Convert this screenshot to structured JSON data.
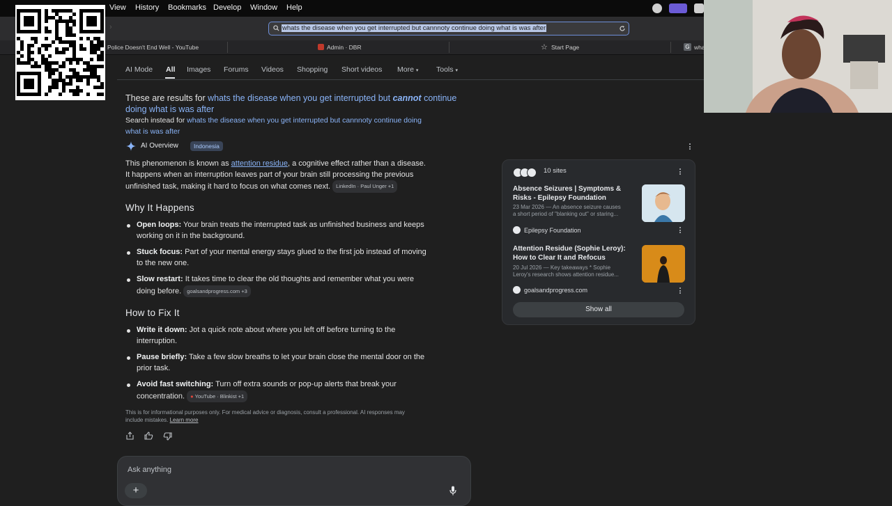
{
  "menubar": {
    "items": [
      "View",
      "History",
      "Bookmarks",
      "Develop",
      "Window",
      "Help"
    ]
  },
  "urlbar": {
    "value": "whats the disease when you get interrupted but cannnoty continue doing what is was after"
  },
  "tabs": [
    {
      "label": "Police Doesn't End Well - YouTube"
    },
    {
      "label": "Admin · DBR"
    },
    {
      "label": "Start Page"
    },
    {
      "label": "wha"
    }
  ],
  "search_nav": {
    "items": [
      "AI Mode",
      "All",
      "Images",
      "Forums",
      "Videos",
      "Shopping",
      "Short videos",
      "More",
      "Tools"
    ],
    "active": "All"
  },
  "spelling": {
    "results_for_prefix": "These are results for",
    "corrected_query_part1": "whats the disease when you get interrupted but",
    "corrected_word": "cannot",
    "corrected_query_part2": "continue doing what is was after",
    "search_instead_prefix": "Search instead for",
    "original_query_line1": "whats the disease when you get interrupted but cannnoty continue doing",
    "original_query_line2": "what is was after"
  },
  "ai_overview": {
    "title": "AI Overview",
    "badge": "Indonesia",
    "intro_before": "This phenomenon is known as",
    "intro_link": "attention residue",
    "intro_after_line1": ", a cognitive effect rather than a disease.",
    "intro_line2": "It happens when an interruption leaves part of your brain still processing the previous",
    "intro_line3": "unfinished task, making it hard to focus on what comes next.",
    "intro_chip": "LinkedIn · Paul Unger +1",
    "why_heading": "Why It Happens",
    "why": [
      {
        "term": "Open loops:",
        "line1": "Your brain treats the interrupted task as unfinished business and keeps",
        "line2": "working on it in the background."
      },
      {
        "term": "Stuck focus:",
        "line1": "Part of your mental energy stays glued to the first job instead of moving",
        "line2": "to the new one."
      },
      {
        "term": "Slow restart:",
        "line1": "It takes time to clear the old thoughts and remember what you were",
        "line2": "doing before.",
        "chip": "goalsandprogress.com +3"
      }
    ],
    "fix_heading": "How to Fix It",
    "fix": [
      {
        "term": "Write it down:",
        "line1": "Jot a quick note about where you left off before turning to the",
        "line2": "interruption."
      },
      {
        "term": "Pause briefly:",
        "line1": "Take a few slow breaths to let your brain close the mental door on the",
        "line2": "prior task."
      },
      {
        "term": "Avoid fast switching:",
        "line1": "Turn off extra sounds or pop-up alerts that break your",
        "line2": "concentration.",
        "chip": "YouTube · Blinkist +1"
      }
    ],
    "disclaimer_line1": "This is for informational purposes only. For medical advice or diagnosis, consult a professional. AI responses may",
    "disclaimer_line2": "include mistakes.",
    "learn_more": "Learn more"
  },
  "sites_card": {
    "count_label": "10 sites",
    "items": [
      {
        "title_line1": "Absence Seizures | Symptoms &",
        "title_line2": "Risks - Epilepsy Foundation",
        "snippet_line1": "23 Mar 2026 — An absence seizure causes",
        "snippet_line2": "a short period of \"blanking out\" or staring...",
        "source": "Epilepsy Foundation"
      },
      {
        "title_line1": "Attention Residue (Sophie Leroy):",
        "title_line2": "How to Clear It and Refocus",
        "snippet_line1": "20 Jul 2026 — Key takeaways * Sophie",
        "snippet_line2": "Leroy's research shows attention residue...",
        "source": "goalsandprogress.com"
      }
    ],
    "show_all": "Show all"
  },
  "ask": {
    "placeholder": "Ask anything"
  },
  "colors": {
    "link": "#8ab4f8",
    "background": "#1f1f1f",
    "card": "#282a2d",
    "url_focus": "#6e8fd8"
  },
  "icons": [
    "qr-code",
    "search-icon",
    "reload-icon",
    "gemini-sparkle-icon",
    "share-icon",
    "thumbs-up-icon",
    "thumbs-down-icon",
    "more-vert-icon",
    "plus-icon",
    "mic-icon",
    "star-icon"
  ]
}
